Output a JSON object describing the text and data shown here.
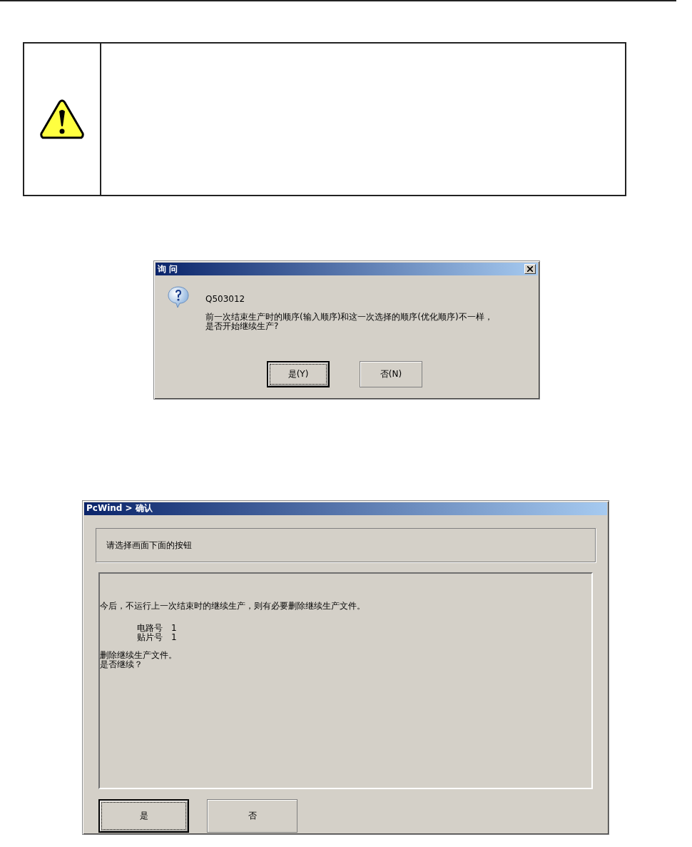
{
  "notice": {
    "kind": "warning"
  },
  "dialog_1": {
    "title": "询 问",
    "code": "Q503012",
    "message": [
      "前一次结束生产时的顺序(输入顺序)和这一次选择的顺序(优化顺序)不一样，",
      "是否开始继续生产?"
    ],
    "buttons": [
      {
        "label": "是(Y)",
        "focused": true
      },
      {
        "label": "否(N)",
        "focused": false
      }
    ]
  },
  "dialog_2": {
    "title": "PcWind > 确认",
    "prompt": "请选择画面下面的按钮",
    "message": "今后，不运行上一次结束时的继续生产，则有必要删除继续生产文件。",
    "fields": [
      {
        "label": "电路号",
        "value": "1"
      },
      {
        "label": "贴片号",
        "value": "1"
      }
    ],
    "footer": [
      "删除继续生产文件。",
      "是否继续？"
    ],
    "buttons": [
      {
        "label": "是",
        "focused": true
      },
      {
        "label": "否",
        "focused": false
      }
    ]
  }
}
